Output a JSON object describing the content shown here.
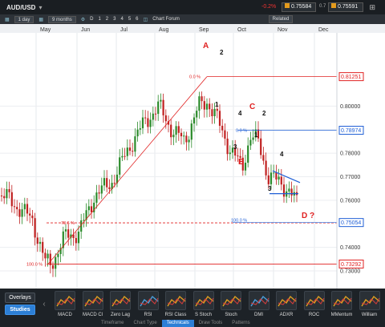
{
  "header": {
    "symbol": "AUD/USD",
    "change": "-0.2%",
    "sell": "0.75584",
    "buy": "0.75591",
    "spread": "0.7"
  },
  "toolbar": {
    "interval": "1 day",
    "range": "9 months",
    "chart_types": [
      "D",
      "1",
      "2",
      "3",
      "4",
      "5",
      "6"
    ],
    "chart_forum": "Chart Forum",
    "related": "Related"
  },
  "months": [
    "May",
    "Jun",
    "Jul",
    "Aug",
    "Sep",
    "Oct",
    "Nov",
    "Dec"
  ],
  "price_labels": [
    {
      "text": "0.81251",
      "value": 0.81251,
      "color": "#e02020",
      "boxed": true
    },
    {
      "text": "0.80000",
      "value": 0.8,
      "color": "#333333",
      "boxed": false
    },
    {
      "text": "0.79000",
      "value": 0.79,
      "color": "#333333",
      "boxed": false
    },
    {
      "text": "0.78974",
      "value": 0.78974,
      "color": "#1f5fd6",
      "boxed": true
    },
    {
      "text": "0.78000",
      "value": 0.78,
      "color": "#333333",
      "boxed": false
    },
    {
      "text": "0.77000",
      "value": 0.77,
      "color": "#333333",
      "boxed": false
    },
    {
      "text": "0.76000",
      "value": 0.76,
      "color": "#333333",
      "boxed": false
    },
    {
      "text": "0.75054",
      "value": 0.75054,
      "color": "#1f5fd6",
      "boxed": true
    },
    {
      "text": "0.74000",
      "value": 0.74,
      "color": "#333333",
      "boxed": false
    },
    {
      "text": "0.73292",
      "value": 0.73292,
      "color": "#e02020",
      "boxed": true
    },
    {
      "text": "0.73000",
      "value": 0.73,
      "color": "#333333",
      "boxed": false
    }
  ],
  "fib_labels": {
    "red_top": "0.0 %",
    "red_mid": "78.6 %",
    "red_bottom": "100.0 %",
    "blue_top": "0.0 %",
    "blue_mid": "100.0 %"
  },
  "wave_labels": {
    "A": "A",
    "B": "B",
    "C": "C",
    "D": "D ?",
    "w1": "1",
    "w2": "2",
    "w3": "3",
    "w4": "4",
    "w1b": "1",
    "w2b": "2",
    "w3b": "3",
    "w4b": "4"
  },
  "bottom": {
    "overlays": "Overlays",
    "studies": "Studies",
    "items": [
      "MACD",
      "MACD Cl",
      "Zero Lag",
      "RSI",
      "RSI Class",
      "S Stoch",
      "Stoch",
      "DMI",
      "ADXR",
      "ROC",
      "MMentum",
      "William"
    ],
    "tabs": [
      "Timeframe",
      "Chart Type",
      "Technicals",
      "Draw Tools",
      "Patterns"
    ],
    "active_tab": "Technicals"
  },
  "colors": {
    "accent": "#2c7fd6",
    "red": "#e02020",
    "blue": "#1f5fd6",
    "candle_up": "#2a8a2a",
    "candle_down": "#c02020"
  }
}
